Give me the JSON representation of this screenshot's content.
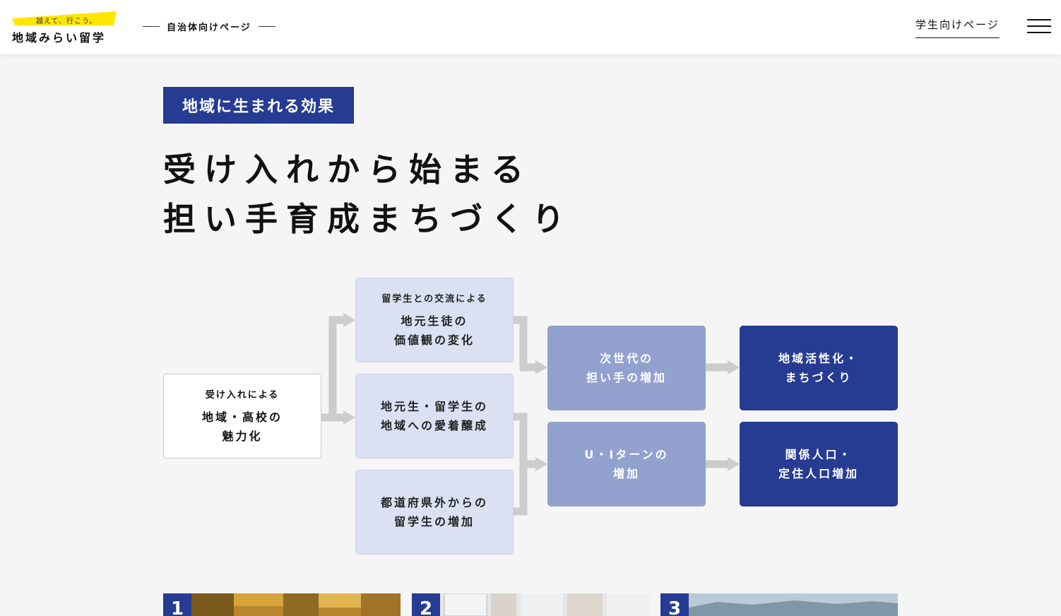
{
  "header": {
    "logo_tagline": "越えて、行こう。",
    "logo_name": "地域みらい留学",
    "municipal_label": "自治体向けページ",
    "student_link": "学生向けページ"
  },
  "section": {
    "badge": "地域に生まれる効果",
    "title_line1": "受け入れから始まる",
    "title_line2": "担い手育成まちづくり"
  },
  "diagram": {
    "start": {
      "sub": "受け入れによる",
      "main1": "地域・高校の",
      "main2": "魅力化"
    },
    "mid1": {
      "sub": "留学生との交流による",
      "main1": "地元生徒の",
      "main2": "価値観の変化"
    },
    "mid2": {
      "main1": "地元生・留学生の",
      "main2": "地域への愛着醸成"
    },
    "mid3": {
      "main1": "都道府県外からの",
      "main2": "留学生の増加"
    },
    "res1": {
      "main1": "次世代の",
      "main2": "担い手の増加"
    },
    "res2": {
      "main1": "U・Iターンの",
      "main2": "増加"
    },
    "out1": {
      "main1": "地域活性化・",
      "main2": "まちづくり"
    },
    "out2": {
      "main1": "関係人口・",
      "main2": "定住人口増加"
    }
  },
  "cards": [
    {
      "number": "1"
    },
    {
      "number": "2"
    },
    {
      "number": "3"
    }
  ],
  "colors": {
    "brand_navy": "#263c92",
    "pale_blue": "#dbe1f3",
    "mid_blue": "#93a1cf",
    "logo_yellow": "#ffe600"
  }
}
